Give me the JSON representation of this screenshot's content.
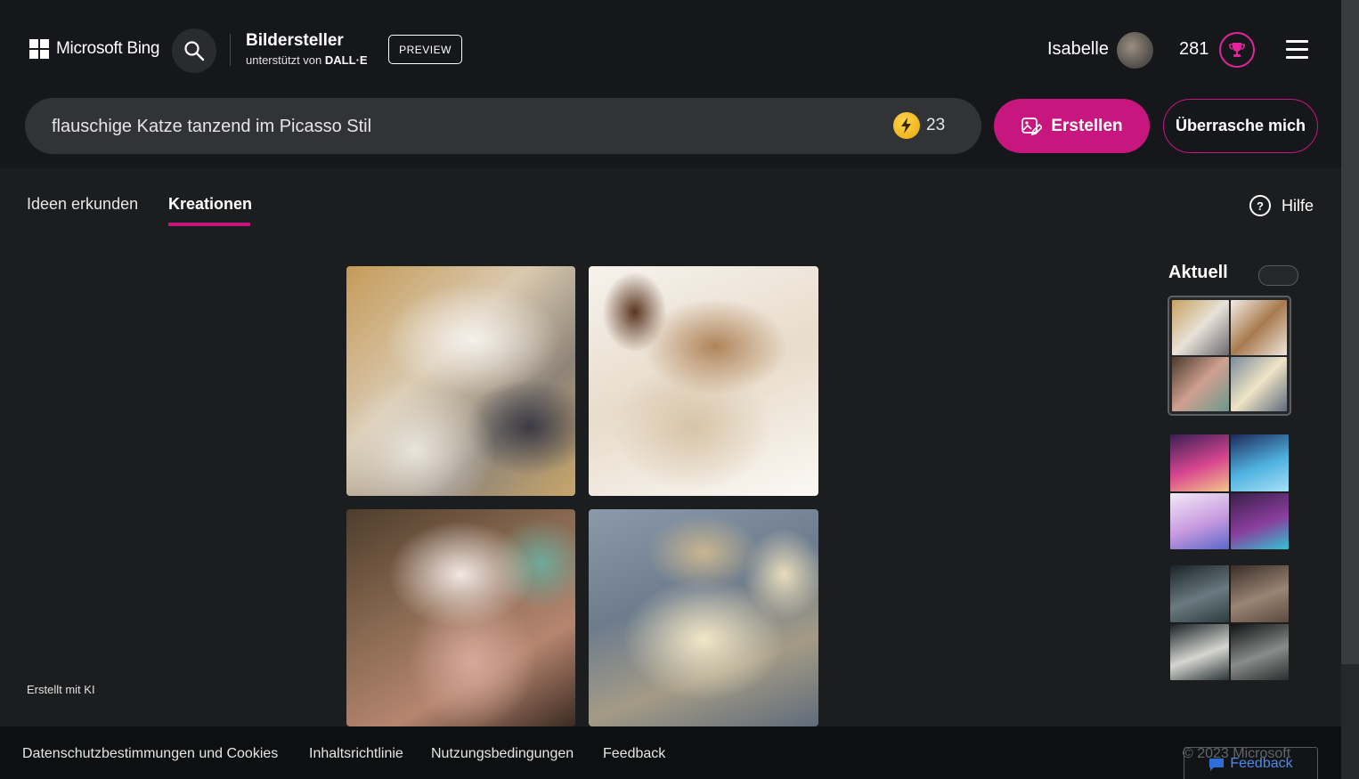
{
  "header": {
    "logo_text": "Microsoft Bing",
    "app_title": "Bildersteller",
    "app_subtitle": "unterstützt von",
    "app_subtitle_brand": "DALL·E",
    "preview_label": "PREVIEW",
    "user_name": "Isabelle",
    "points": "281"
  },
  "search": {
    "value": "flauschige Katze tanzend im Picasso Stil",
    "boost_count": "23",
    "create_label": "Erstellen",
    "surprise_label": "Überrasche mich"
  },
  "tabs": [
    {
      "label": "Ideen erkunden"
    },
    {
      "label": "Kreationen"
    }
  ],
  "help_label": "Hilfe",
  "sidebar": {
    "title": "Aktuell"
  },
  "made_with_ai": "Erstellt mit KI",
  "footer": {
    "links": [
      "Datenschutzbestimmungen und Cookies",
      "Inhaltsrichtlinie",
      "Nutzungsbedingungen",
      "Feedback"
    ],
    "copyright": "© 2023 Microsoft",
    "feedback_button": "Feedback"
  },
  "colors": {
    "accent": "#c7177f",
    "background": "#1c1d1f",
    "header_background": "#16171a"
  },
  "icons": {
    "search": "search-icon",
    "boost": "lightning-icon",
    "create": "image-edit-icon",
    "trophy": "trophy-icon",
    "menu": "hamburger-icon",
    "help": "help-icon",
    "feedback": "chat-bubble-icon"
  }
}
